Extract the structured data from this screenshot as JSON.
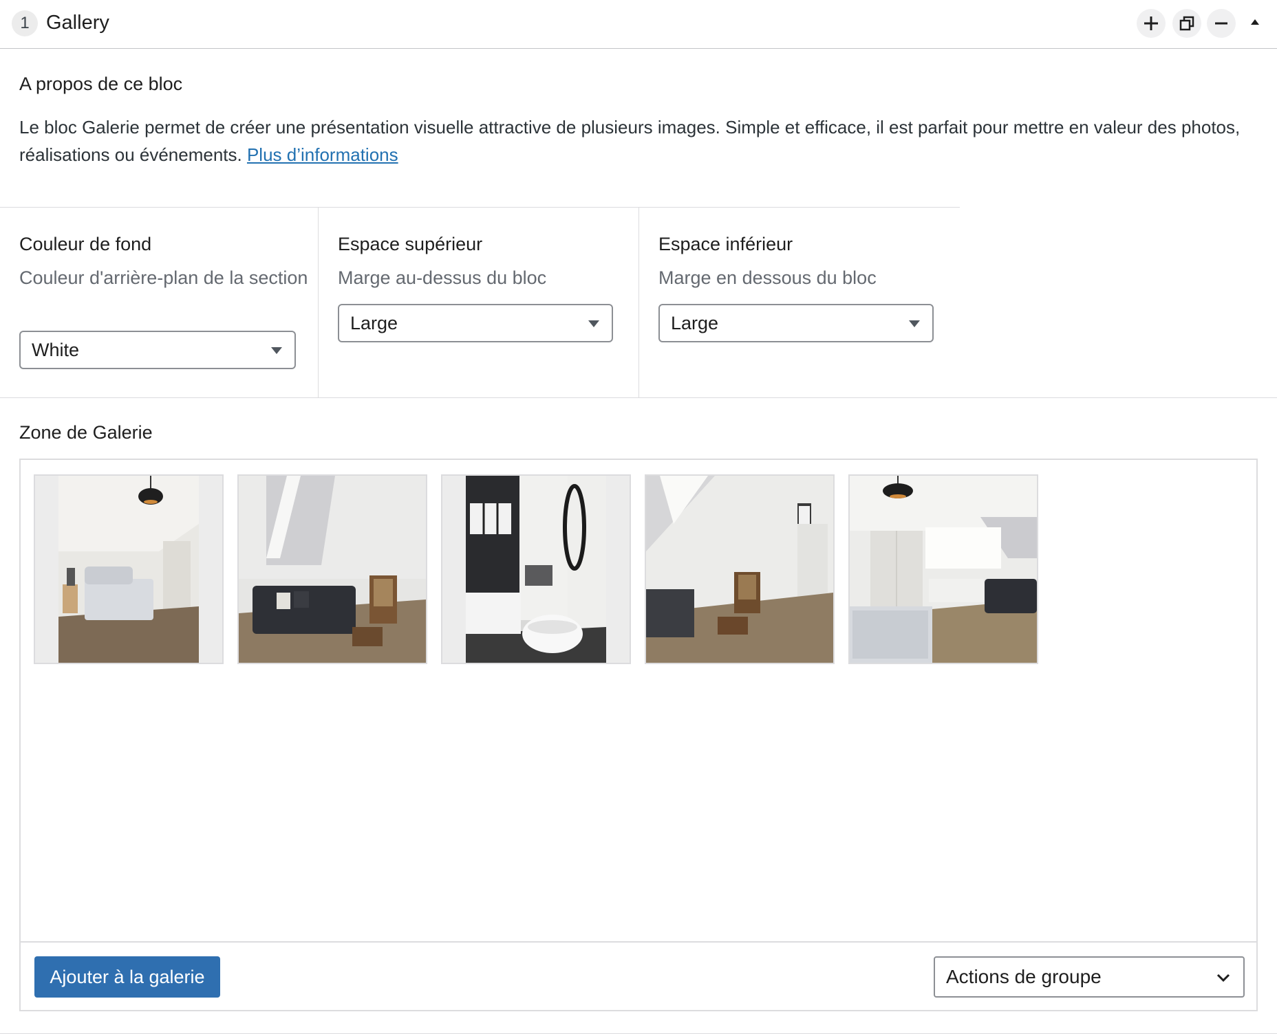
{
  "header": {
    "index": "1",
    "title": "Gallery",
    "controls": [
      "plus-icon",
      "duplicate-icon",
      "minus-icon",
      "collapse-arrow-icon"
    ]
  },
  "about": {
    "title": "A propos de ce bloc",
    "text": "Le bloc Galerie permet de créer une présentation visuelle attractive de plusieurs images. Simple et efficace, il est parfait pour mettre en valeur des photos, réalisations ou événements. ",
    "link_label": "Plus d’informations"
  },
  "settings": {
    "background": {
      "label": "Couleur de fond",
      "help": "Couleur d'arrière-plan de la section",
      "value": "White"
    },
    "top_spacing": {
      "label": "Espace supérieur",
      "help": "Marge au-dessus du bloc",
      "value": "Large"
    },
    "bottom_spacing": {
      "label": "Espace inférieur",
      "help": "Marge en dessous du bloc",
      "value": "Large"
    }
  },
  "gallery": {
    "title": "Zone de Galerie",
    "images": [
      {
        "orientation": "portrait"
      },
      {
        "orientation": "landscape"
      },
      {
        "orientation": "portrait"
      },
      {
        "orientation": "landscape"
      },
      {
        "orientation": "landscape"
      }
    ],
    "add_button": "Ajouter à la galerie",
    "bulk_actions": "Actions de groupe"
  },
  "colors": {
    "accent": "#2f6fb0",
    "link": "#2271b1",
    "border": "#dcdcde",
    "muted_text": "#646970"
  }
}
